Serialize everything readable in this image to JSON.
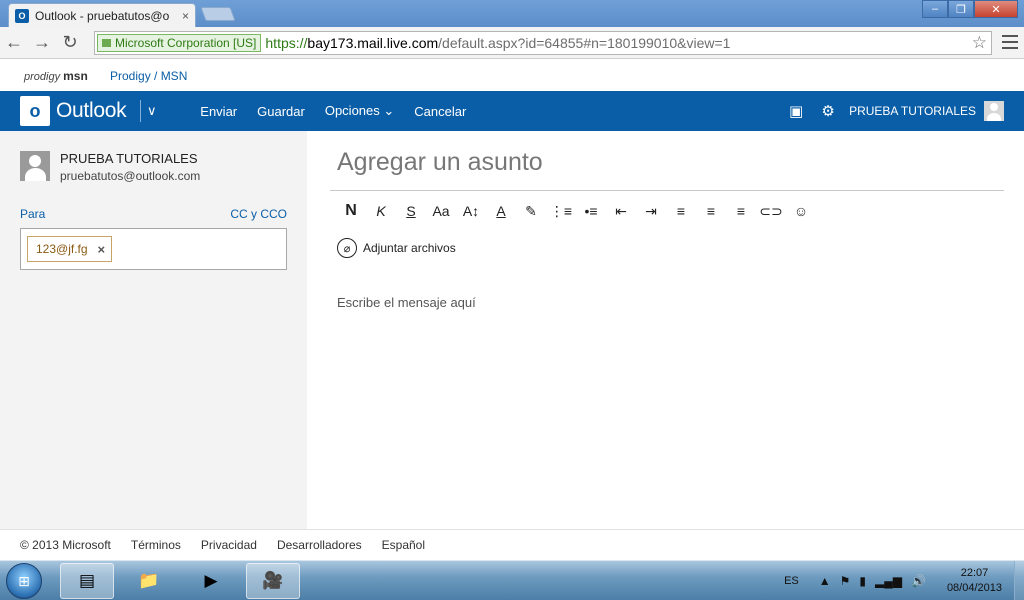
{
  "browser": {
    "tab_title": "Outlook - pruebatutos@o",
    "tab_favicon": "O",
    "tab_close": "×",
    "ev_cert": "Microsoft Corporation [US]",
    "url_scheme": "https://",
    "url_host": "bay173.mail.live.com",
    "url_path": "/default.aspx?id=64855#n=180199010&view=1",
    "back_icon": "←",
    "forward_icon": "→",
    "reload_icon": "↻",
    "star_icon": "☆"
  },
  "prodigy": {
    "logo": "msn",
    "logo_prefix": "prodigy",
    "link": "Prodigy / MSN"
  },
  "outlook_header": {
    "brand": "Outlook",
    "logo_letter": "o",
    "actions": [
      "Enviar",
      "Guardar",
      "Opciones",
      "Cancelar"
    ],
    "options_chevron": "⌄",
    "user_name": "PRUEBA TUTORIALES",
    "colors": {
      "header_bg": "#0a5ea8"
    }
  },
  "sender": {
    "name": "PRUEBA TUTORIALES",
    "email": "pruebatutos@outlook.com"
  },
  "recipients": {
    "to_label": "Para",
    "cc_label": "CC y CCO",
    "chips": [
      {
        "address": "123@jf.fg",
        "remove": "×"
      }
    ]
  },
  "compose": {
    "subject_placeholder": "Agregar un asunto",
    "format_buttons": [
      "N",
      "K",
      "S",
      "Aa",
      "A↕",
      "A",
      "✎",
      "⋮≡",
      "•≡",
      "⇤",
      "⇥",
      "≡",
      "≡",
      "≡",
      "⊂⊃",
      "☺"
    ],
    "attach_label": "Adjuntar archivos",
    "attach_icon": "⌀",
    "body_placeholder": "Escribe el mensaje aquí"
  },
  "footer": {
    "links": [
      "© 2013 Microsoft",
      "Términos",
      "Privacidad",
      "Desarrolladores",
      "Español"
    ]
  },
  "taskbar": {
    "start_icon": "⊞",
    "apps": [
      "▤",
      "📁",
      "▶",
      "🎥"
    ],
    "lang": "ES",
    "tray_icons": [
      "▲",
      "⚑",
      "▮",
      "▂▄▆",
      "🔊"
    ],
    "time": "22:07",
    "date": "08/04/2013"
  }
}
